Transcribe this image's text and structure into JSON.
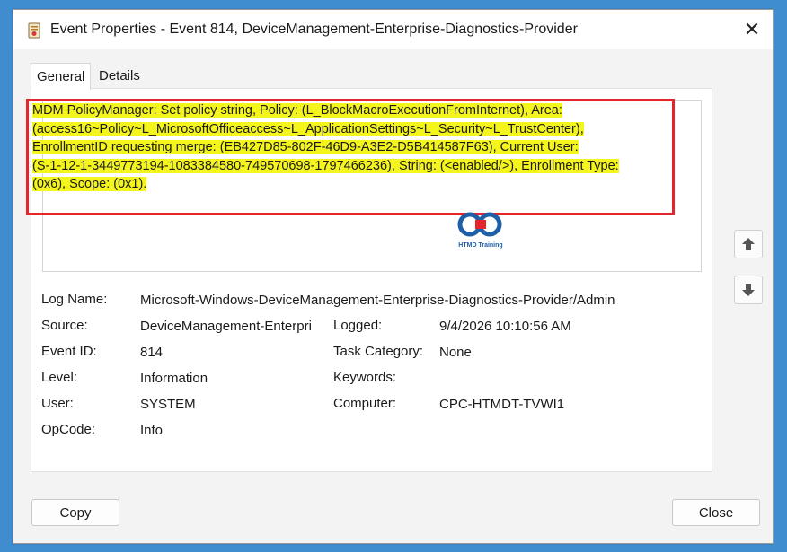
{
  "window": {
    "title": "Event Properties - Event 814, DeviceManagement-Enterprise-Diagnostics-Provider",
    "close_glyph": "✕"
  },
  "tabs": [
    {
      "label": "General",
      "active": true
    },
    {
      "label": "Details",
      "active": false
    }
  ],
  "description": {
    "lines": [
      "MDM PolicyManager: Set policy string, Policy: (L_BlockMacroExecutionFromInternet), Area:",
      "(access16~Policy~L_MicrosoftOfficeaccess~L_ApplicationSettings~L_Security~L_TrustCenter),",
      "EnrollmentID requesting merge: (EB427D85-802F-46D9-A3E2-D5B414587F63), Current User:",
      "(S-1-12-1-3449773194-1083384580-749570698-1797466236), String: (<enabled/>), Enrollment Type:",
      "(0x6), Scope: (0x1)."
    ],
    "highlight_color": "#f5f51e",
    "annotation_color": "#e4262c"
  },
  "watermark": {
    "text": "HTMD Training",
    "color": "#1e5fa8"
  },
  "fields": {
    "log_name": {
      "label": "Log Name:",
      "value": "Microsoft-Windows-DeviceManagement-Enterprise-Diagnostics-Provider/Admin"
    },
    "source": {
      "label": "Source:",
      "value": "DeviceManagement-Enterpri"
    },
    "logged": {
      "label": "Logged:",
      "value": "9/4/2026 10:10:56 AM"
    },
    "event_id": {
      "label": "Event ID:",
      "value": "814"
    },
    "task_category": {
      "label": "Task Category:",
      "value": "None"
    },
    "level": {
      "label": "Level:",
      "value": "Information"
    },
    "keywords": {
      "label": "Keywords:",
      "value": ""
    },
    "user": {
      "label": "User:",
      "value": "SYSTEM"
    },
    "computer": {
      "label": "Computer:",
      "value": "CPC-HTMDT-TVWI1"
    },
    "opcode": {
      "label": "OpCode:",
      "value": "Info"
    }
  },
  "buttons": {
    "copy": "Copy",
    "close": "Close"
  },
  "icons": {
    "title": "event-viewer-icon",
    "up": "arrow-up-icon",
    "down": "arrow-down-icon",
    "close": "close-icon"
  }
}
